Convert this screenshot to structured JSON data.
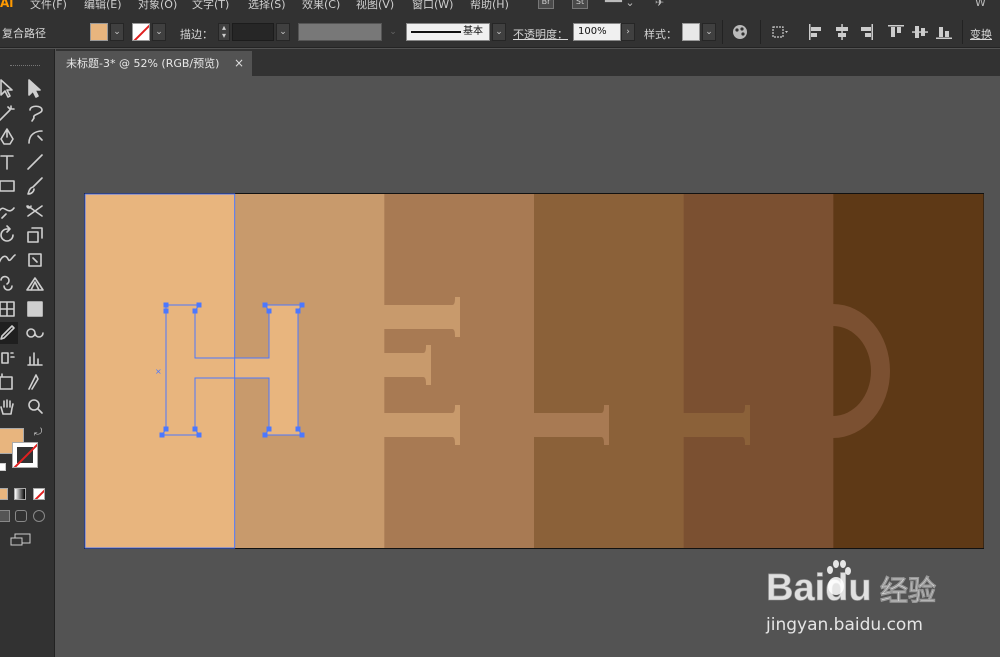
{
  "app": {
    "logo": "Ai",
    "menus": [
      "文件(F)",
      "编辑(E)",
      "对象(O)",
      "文字(T)",
      "选择(S)",
      "效果(C)",
      "视图(V)",
      "窗口(W)",
      "帮助(H)"
    ],
    "bridge_label": "Br",
    "stock_label": "St",
    "workspace_hint": "W"
  },
  "control_bar": {
    "selection_type": "复合路径",
    "fill_color": "#e8b57e",
    "stroke_label": "描边：",
    "stroke_style": "基本",
    "opacity_label": "不透明度：",
    "opacity_value": "100%",
    "style_label": "样式：",
    "transform_label": "变换"
  },
  "toolbar": {
    "fill_swatch_color": "#e8b57e",
    "tools": [
      "selection-tool",
      "direct-selection-tool",
      "magic-wand-tool",
      "lasso-tool",
      "pen-tool",
      "curvature-tool",
      "type-tool",
      "line-tool",
      "rectangle-tool",
      "paintbrush-tool",
      "shaper-tool",
      "scissors-tool",
      "rotate-tool",
      "scale-tool",
      "warp-tool",
      "free-transform-tool",
      "shape-builder-tool",
      "perspective-grid-tool",
      "mesh-tool",
      "gradient-tool",
      "eyedropper-tool",
      "blend-tool",
      "symbol-sprayer-tool",
      "column-graph-tool",
      "artboard-tool",
      "slice-tool",
      "hand-tool",
      "zoom-tool"
    ]
  },
  "document": {
    "tab_title": "未标题-3* @ 52% (RGB/预览)",
    "close_glyph": "×"
  },
  "artwork": {
    "band_colors": [
      "#e8b57e",
      "#c89a6c",
      "#a87a53",
      "#8b6139",
      "#7b5031",
      "#5e3916"
    ],
    "letter_colors": [
      "#e8b57e",
      "#c89a6c",
      "#a87a53",
      "#8b6139"
    ],
    "selection_color": "#4b78ff",
    "letters": [
      "H",
      "E",
      "L",
      "L",
      "O"
    ]
  },
  "watermark": {
    "brand": "Baidu",
    "product": "经验",
    "url": "jingyan.baidu.com"
  }
}
